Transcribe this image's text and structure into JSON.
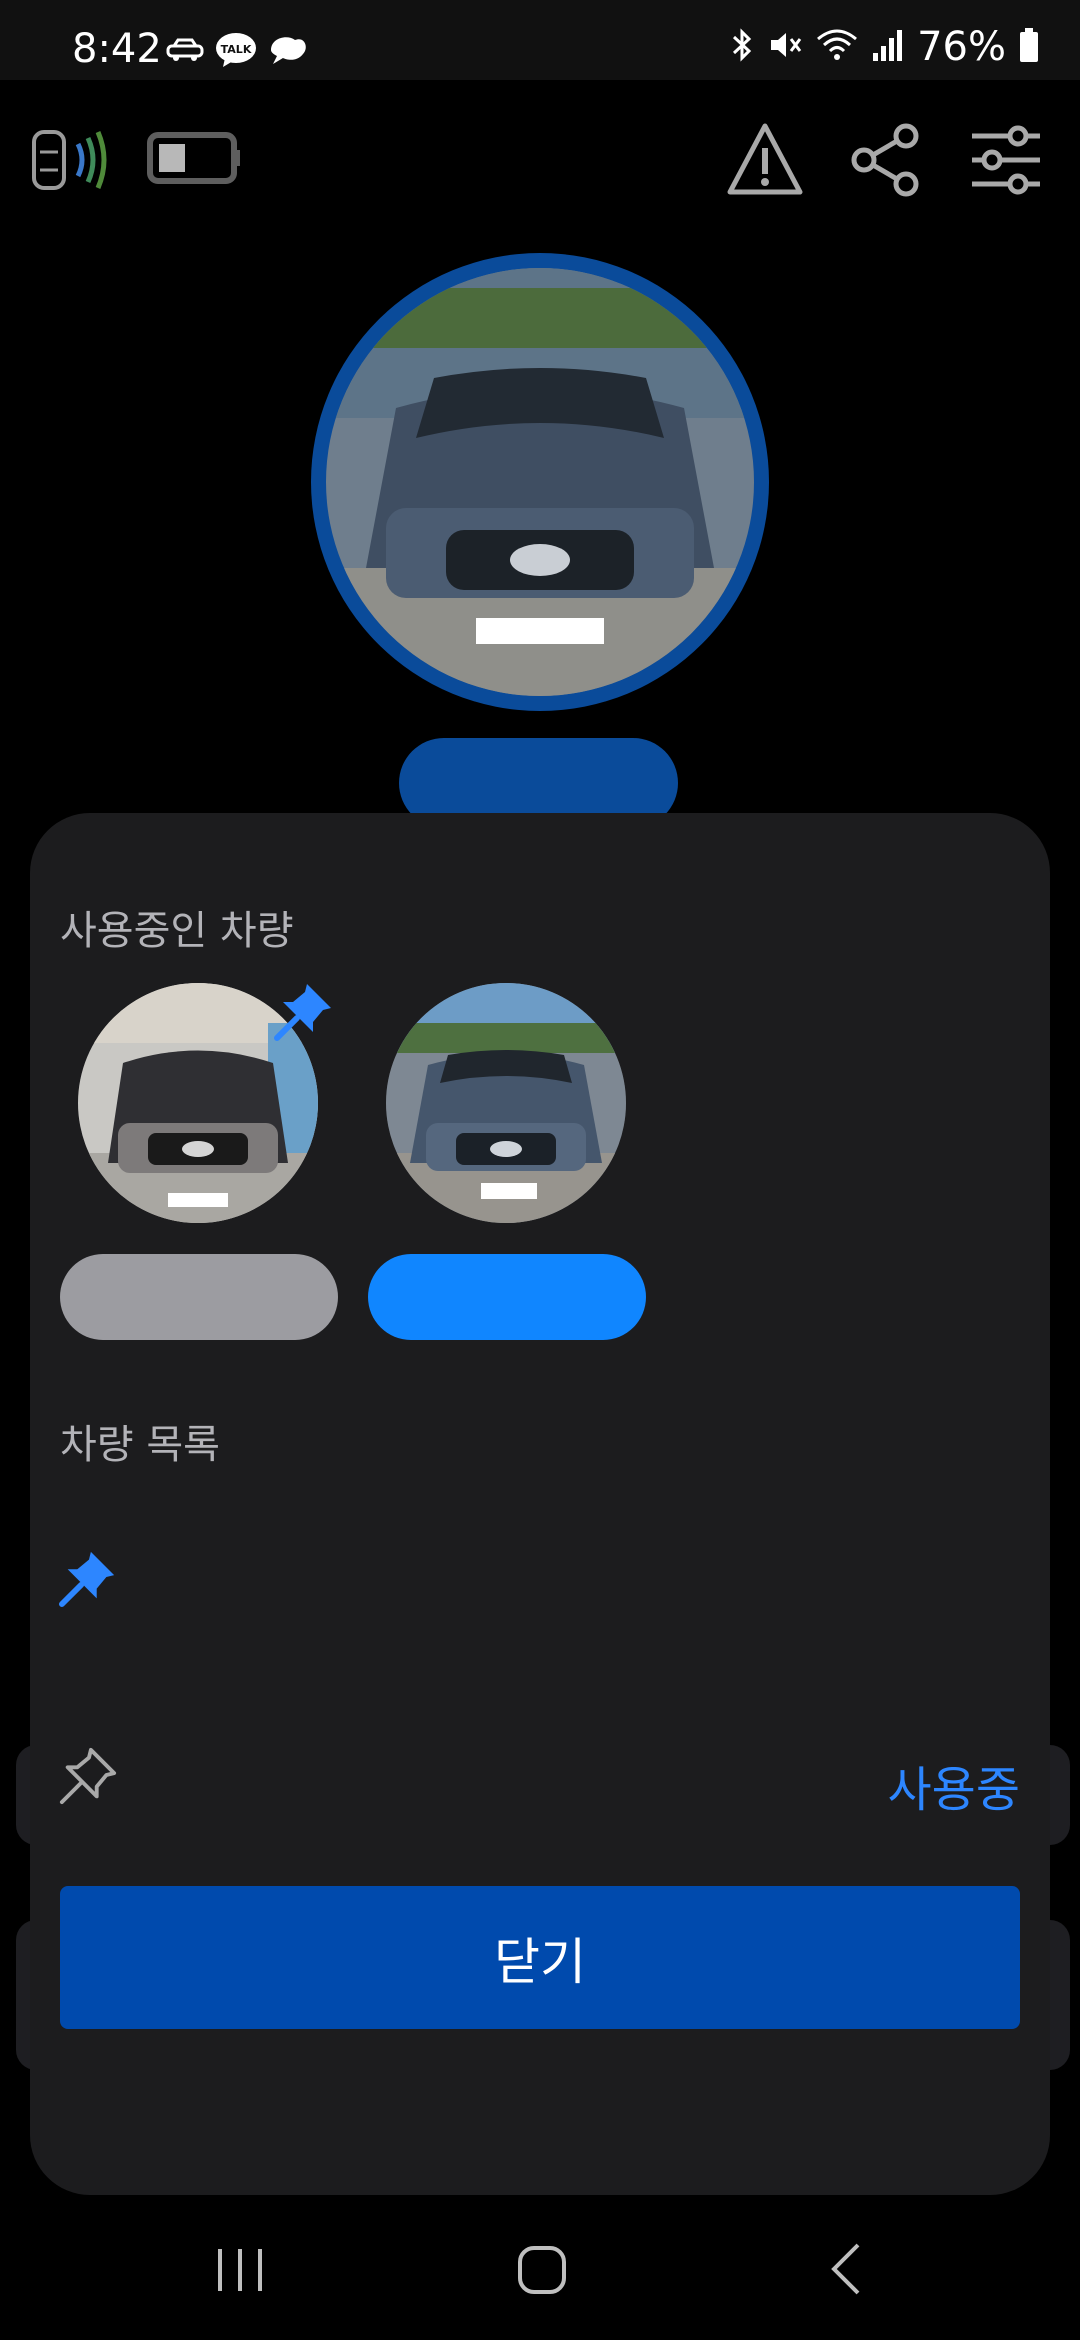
{
  "status_bar": {
    "time": "8:42",
    "battery_percent": "76%",
    "left_icons": [
      "car-icon",
      "kakaotalk-icon",
      "chat-bubble-icon"
    ],
    "right_icons": [
      "bluetooth-icon",
      "mute-icon",
      "wifi-icon",
      "signal-icon",
      "battery-icon"
    ]
  },
  "top_bar": {
    "icons": [
      "car-connection-icon",
      "battery-status-icon",
      "warning-icon",
      "share-icon",
      "settings-sliders-icon"
    ]
  },
  "sheet": {
    "in_use_title": "사용중인 차량",
    "vehicle_list_title": "차량 목록",
    "in_use_label": "사용중",
    "close_label": "닫기"
  },
  "colors": {
    "accent": "#2d86ff",
    "primary_button": "#004aad",
    "ring": "#0a4b9a",
    "pill_active": "#1086ff",
    "pill_inactive": "#9c9ca1",
    "sheet_bg": "#1c1c1e"
  },
  "nav": {
    "icons": [
      "recent-apps-icon",
      "home-icon",
      "back-icon"
    ]
  }
}
